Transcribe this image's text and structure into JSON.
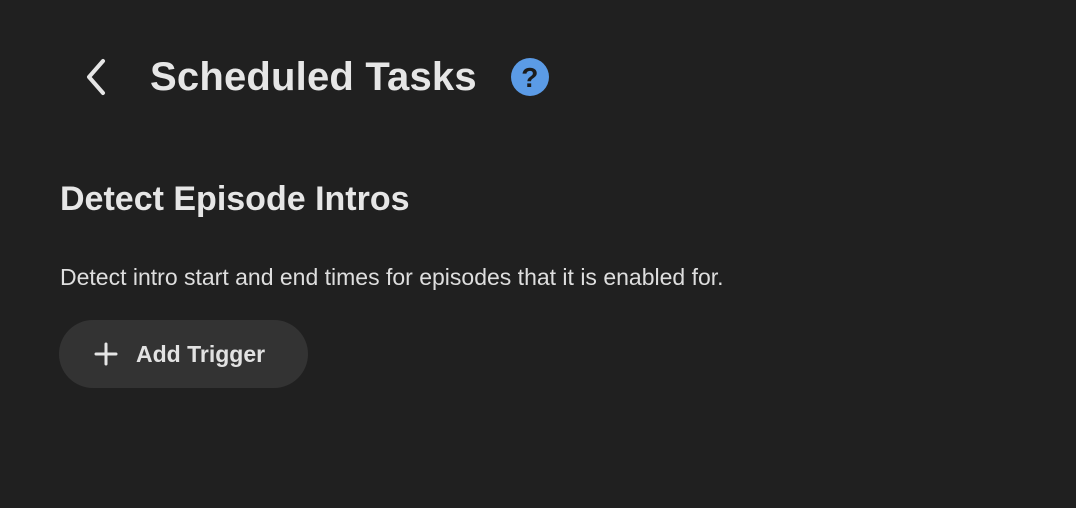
{
  "header": {
    "back_icon": "chevron-left-icon",
    "title": "Scheduled Tasks",
    "help_icon": "question-mark-icon",
    "help_glyph": "?",
    "help_color": "#5b9be6"
  },
  "task": {
    "name": "Detect Episode Intros",
    "description": "Detect intro start and end times for episodes that it is enabled for."
  },
  "actions": {
    "add_trigger_icon": "plus-icon",
    "add_trigger_label": "Add Trigger"
  },
  "colors": {
    "background": "#202020",
    "button_background": "#333333",
    "text": "#e6e6e6"
  }
}
